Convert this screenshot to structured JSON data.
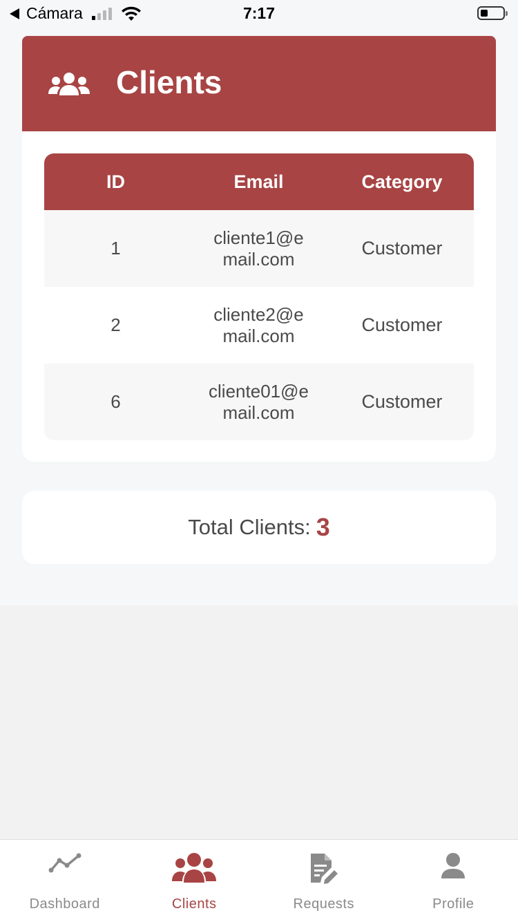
{
  "status_bar": {
    "back_label": "Cámara",
    "time": "7:17"
  },
  "header": {
    "title": "Clients",
    "icon": "users-icon"
  },
  "table": {
    "columns": [
      "ID",
      "Email",
      "Category"
    ],
    "rows": [
      {
        "id": "1",
        "email": "cliente1@email.com",
        "category": "Customer"
      },
      {
        "id": "2",
        "email": "cliente2@email.com",
        "category": "Customer"
      },
      {
        "id": "6",
        "email": "cliente01@email.com",
        "category": "Customer"
      }
    ]
  },
  "summary": {
    "label": "Total Clients:",
    "value": "3"
  },
  "tabbar": {
    "tabs": [
      {
        "label": "Dashboard",
        "icon": "chart-line-icon",
        "active": false
      },
      {
        "label": "Clients",
        "icon": "users-icon",
        "active": true
      },
      {
        "label": "Requests",
        "icon": "document-edit-icon",
        "active": false
      },
      {
        "label": "Profile",
        "icon": "user-icon",
        "active": false
      }
    ]
  },
  "colors": {
    "accent": "#a84444",
    "background": "#f6f7f9",
    "tab_inactive": "#8a8a8a"
  }
}
